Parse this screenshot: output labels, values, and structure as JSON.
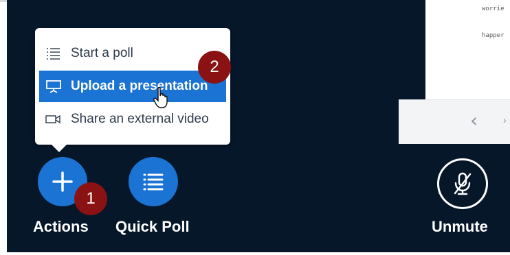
{
  "slide": {
    "lines": [
      "worrie",
      "happer"
    ]
  },
  "menu": {
    "items": [
      {
        "label": "Start a poll",
        "icon": "poll-list-icon"
      },
      {
        "label": "Upload a presentation",
        "icon": "presentation-icon"
      },
      {
        "label": "Share an external video",
        "icon": "video-icon"
      }
    ]
  },
  "badges": [
    "1",
    "2"
  ],
  "actions": {
    "actions_label": "Actions",
    "quick_poll_label": "Quick Poll",
    "unmute_label": "Unmute"
  },
  "colors": {
    "background": "#06172a",
    "accent": "#1b73d3",
    "badge": "#8b1212"
  }
}
